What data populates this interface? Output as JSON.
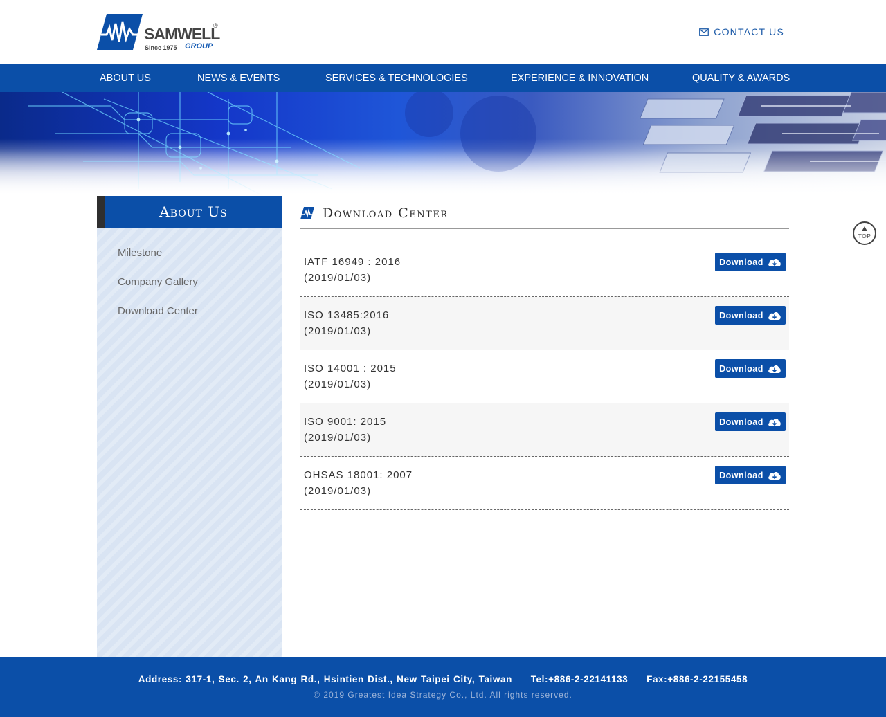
{
  "brand": {
    "name": "SAMWELL",
    "registered": "®",
    "since": "Since 1975",
    "group": "GROUP"
  },
  "header": {
    "contact_label": "CONTACT US",
    "contact_icon": "envelope-icon"
  },
  "nav": {
    "items": [
      {
        "label": "ABOUT US"
      },
      {
        "label": "NEWS & EVENTS"
      },
      {
        "label": "SERVICES & TECHNOLOGIES"
      },
      {
        "label": "EXPERIENCE & INNOVATION"
      },
      {
        "label": "QUALITY & AWARDS"
      }
    ]
  },
  "sidebar": {
    "title": "About Us",
    "items": [
      {
        "label": "Milestone"
      },
      {
        "label": "Company Gallery"
      },
      {
        "label": "Download Center"
      }
    ]
  },
  "main": {
    "section_title": "Download Center",
    "download_label": "Download",
    "download_icon": "cloud-download-icon",
    "documents": [
      {
        "title": "IATF 16949 : 2016",
        "date": "(2019/01/03)"
      },
      {
        "title": "ISO 13485:2016",
        "date": "(2019/01/03)"
      },
      {
        "title": "ISO 14001 : 2015",
        "date": "(2019/01/03)"
      },
      {
        "title": "ISO 9001: 2015",
        "date": "(2019/01/03)"
      },
      {
        "title": "OHSAS 18001: 2007",
        "date": "(2019/01/03)"
      }
    ]
  },
  "top_button": {
    "label": "TOP"
  },
  "footer": {
    "address": "Address: 317-1, Sec. 2, An Kang Rd., Hsintien Dist., New Taipei City, Taiwan     Tel:+886-2-22141133     Fax:+886-2-22155458",
    "copyright": "© 2019 Greatest Idea Strategy Co., Ltd. All rights reserved."
  },
  "colors": {
    "brand_blue": "#0b4fa8",
    "sidebar_bg": "#d9e4f3",
    "text": "#333333"
  }
}
